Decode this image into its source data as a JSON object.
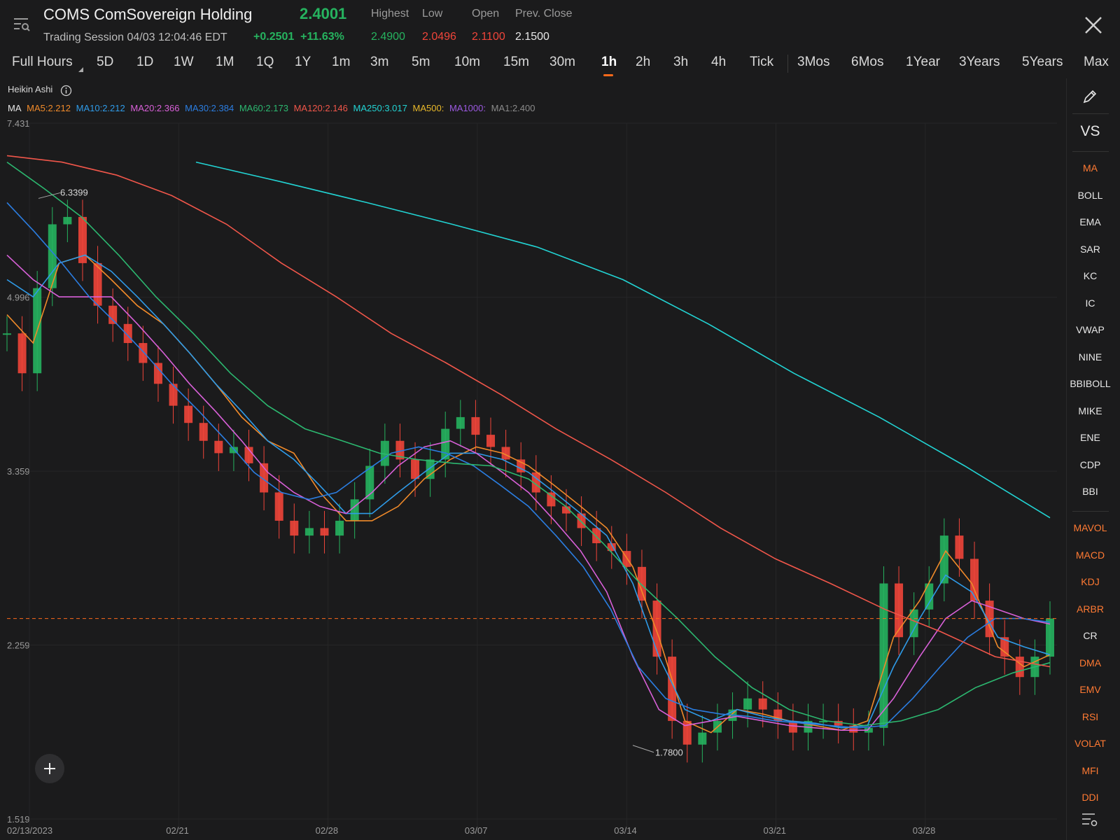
{
  "header": {
    "title": "COMS ComSovereign Holding",
    "price": "2.4001",
    "session": "Trading Session 04/03 12:04:46 EDT",
    "change": "+0.2501",
    "change_pct": "+11.63%",
    "labels": {
      "highest": "Highest",
      "low": "Low",
      "open": "Open",
      "prev_close": "Prev. Close"
    },
    "values": {
      "highest": "2.4900",
      "low": "2.0496",
      "open": "2.1100",
      "prev_close": "2.1500"
    },
    "colors": {
      "up": "#26b35f",
      "down": "#f0453a",
      "neutral": "#e6e6e6"
    }
  },
  "timeframes": {
    "items": [
      "Full Hours",
      "5D",
      "1D",
      "1W",
      "1M",
      "1Q",
      "1Y",
      "1m",
      "3m",
      "5m",
      "10m",
      "15m",
      "30m",
      "1h",
      "2h",
      "3h",
      "4h",
      "Tick",
      "3Mos",
      "6Mos",
      "1Year",
      "3Years",
      "5Years",
      "Max"
    ],
    "active": "1h"
  },
  "chart_header": {
    "chart_type": "Heikin Ashi",
    "ma_label": "MA",
    "ma_items": [
      {
        "text": "MA5:2.212",
        "color": "#f08a2a"
      },
      {
        "text": "MA10:2.212",
        "color": "#2f9be8"
      },
      {
        "text": "MA20:2.366",
        "color": "#d860d8"
      },
      {
        "text": "MA30:2.384",
        "color": "#2b7de0"
      },
      {
        "text": "MA60:2.173",
        "color": "#2cb870"
      },
      {
        "text": "MA120:2.146",
        "color": "#f0564a"
      },
      {
        "text": "MA250:3.017",
        "color": "#22d3d3"
      },
      {
        "text": "MA500:",
        "color": "#e8b82a"
      },
      {
        "text": "MA1000:",
        "color": "#9b59e0"
      },
      {
        "text": "MA1:2.400",
        "color": "#8a8a8a"
      }
    ]
  },
  "chart_data": {
    "type": "line",
    "y_labels": [
      "7.431",
      "4.996",
      "3.359",
      "2.259",
      "1.519"
    ],
    "x_labels": [
      "02/13/2023",
      "02/21",
      "02/28",
      "03/07",
      "03/14",
      "03/21",
      "03/28"
    ],
    "ylim": [
      1.519,
      7.431
    ],
    "y_scale": "log",
    "annotations": [
      {
        "text": "6.3399"
      },
      {
        "text": "1.7800"
      }
    ],
    "current_price_line": 2.4,
    "grid": true,
    "candles_close_trend": [
      4.6,
      4.2,
      5.1,
      5.9,
      6.0,
      5.4,
      4.9,
      4.7,
      4.5,
      4.3,
      4.1,
      3.9,
      3.75,
      3.6,
      3.5,
      3.55,
      3.42,
      3.2,
      3.0,
      2.9,
      2.95,
      2.9,
      3.0,
      3.15,
      3.4,
      3.6,
      3.45,
      3.3,
      3.45,
      3.7,
      3.8,
      3.65,
      3.55,
      3.45,
      3.35,
      3.2,
      3.1,
      3.05,
      2.95,
      2.85,
      2.8,
      2.7,
      2.5,
      2.2,
      1.9,
      1.8,
      1.85,
      1.9,
      1.95,
      2.0,
      1.95,
      1.9,
      1.85,
      1.9,
      1.9,
      1.88,
      1.85,
      1.87,
      2.6,
      2.3,
      2.45,
      2.6,
      2.9,
      2.75,
      2.5,
      2.3,
      2.2,
      2.1,
      2.2,
      2.4
    ],
    "series": [
      {
        "name": "MA5",
        "color": "#f08a2a",
        "values": [
          4.8,
          4.5,
          5.4,
          5.5,
          5.2,
          4.9,
          4.7,
          4.4,
          4.1,
          3.8,
          3.6,
          3.5,
          3.2,
          3.0,
          3.0,
          3.1,
          3.3,
          3.45,
          3.55,
          3.5,
          3.4,
          3.25,
          3.1,
          2.95,
          2.7,
          2.3,
          1.9,
          1.85,
          1.95,
          1.93,
          1.9,
          1.88,
          1.86,
          1.9,
          2.3,
          2.5,
          2.8,
          2.6,
          2.25,
          2.15,
          2.21
        ]
      },
      {
        "name": "MA10",
        "color": "#2f9be8",
        "values": [
          5.2,
          5.0,
          5.4,
          5.5,
          5.3,
          5.0,
          4.7,
          4.4,
          4.1,
          3.85,
          3.6,
          3.45,
          3.25,
          3.05,
          3.05,
          3.2,
          3.35,
          3.5,
          3.5,
          3.45,
          3.35,
          3.2,
          3.05,
          2.9,
          2.6,
          2.2,
          1.95,
          1.9,
          1.95,
          1.92,
          1.9,
          1.89,
          1.87,
          1.88,
          2.15,
          2.4,
          2.65,
          2.55,
          2.3,
          2.25,
          2.21
        ]
      },
      {
        "name": "MA20",
        "color": "#d860d8",
        "values": [
          5.5,
          5.2,
          5.0,
          5.0,
          5.0,
          4.7,
          4.4,
          4.1,
          3.85,
          3.6,
          3.35,
          3.2,
          3.1,
          3.05,
          3.2,
          3.4,
          3.55,
          3.6,
          3.5,
          3.35,
          3.2,
          3.0,
          2.8,
          2.55,
          2.2,
          1.95,
          1.88,
          1.9,
          1.92,
          1.9,
          1.88,
          1.87,
          1.86,
          1.86,
          2.0,
          2.2,
          2.4,
          2.5,
          2.45,
          2.4,
          2.37
        ]
      },
      {
        "name": "MA30",
        "color": "#2b7de0",
        "values": [
          6.2,
          5.8,
          5.4,
          5.0,
          4.7,
          4.4,
          4.1,
          3.85,
          3.6,
          3.35,
          3.2,
          3.15,
          3.2,
          3.35,
          3.5,
          3.55,
          3.5,
          3.4,
          3.25,
          3.1,
          2.9,
          2.7,
          2.45,
          2.15,
          2.0,
          1.95,
          1.93,
          1.92,
          1.9,
          1.89,
          1.88,
          1.87,
          1.88,
          2.0,
          2.15,
          2.3,
          2.4,
          2.4,
          2.38
        ]
      },
      {
        "name": "MA60",
        "color": "#2cb870",
        "values": [
          6.8,
          6.4,
          6.0,
          5.5,
          5.0,
          4.6,
          4.2,
          3.9,
          3.7,
          3.6,
          3.5,
          3.45,
          3.42,
          3.4,
          3.3,
          3.1,
          2.85,
          2.6,
          2.4,
          2.2,
          2.05,
          1.95,
          1.9,
          1.88,
          1.9,
          1.95,
          2.05,
          2.12,
          2.17
        ]
      },
      {
        "name": "MA120",
        "color": "#f0564a",
        "values": [
          6.9,
          6.8,
          6.6,
          6.3,
          5.9,
          5.4,
          5.0,
          4.6,
          4.3,
          4.0,
          3.7,
          3.45,
          3.2,
          2.95,
          2.75,
          2.6,
          2.45,
          2.33,
          2.2,
          2.15
        ]
      },
      {
        "name": "MA250",
        "color": "#22d3d3",
        "values": [
          6.8,
          6.5,
          6.2,
          5.9,
          5.6,
          5.2,
          4.7,
          4.2,
          3.8,
          3.4,
          3.02
        ]
      }
    ]
  },
  "sidebar": {
    "top_items": [
      "VS"
    ],
    "items": [
      {
        "label": "MA",
        "active": true
      },
      {
        "label": "BOLL",
        "active": false
      },
      {
        "label": "EMA",
        "active": false
      },
      {
        "label": "SAR",
        "active": false
      },
      {
        "label": "KC",
        "active": false
      },
      {
        "label": "IC",
        "active": false
      },
      {
        "label": "VWAP",
        "active": false
      },
      {
        "label": "NINE",
        "active": false
      },
      {
        "label": "BBIBOLL",
        "active": false
      },
      {
        "label": "MIKE",
        "active": false
      },
      {
        "label": "ENE",
        "active": false
      },
      {
        "label": "CDP",
        "active": false
      },
      {
        "label": "BBI",
        "active": false
      }
    ],
    "sub_items": [
      {
        "label": "MAVOL",
        "active": true
      },
      {
        "label": "MACD",
        "active": true
      },
      {
        "label": "KDJ",
        "active": true
      },
      {
        "label": "ARBR",
        "active": true
      },
      {
        "label": "CR",
        "active": false
      },
      {
        "label": "DMA",
        "active": true
      },
      {
        "label": "EMV",
        "active": true
      },
      {
        "label": "RSI",
        "active": true
      },
      {
        "label": "VOLAT",
        "active": true
      },
      {
        "label": "MFI",
        "active": true
      },
      {
        "label": "DDI",
        "active": true
      }
    ]
  },
  "icons": {
    "menu": "menu-search-icon",
    "close": "close-icon",
    "pencil": "pencil-icon",
    "add": "plus-icon",
    "settings": "list-settings-icon",
    "info": "info-icon"
  }
}
